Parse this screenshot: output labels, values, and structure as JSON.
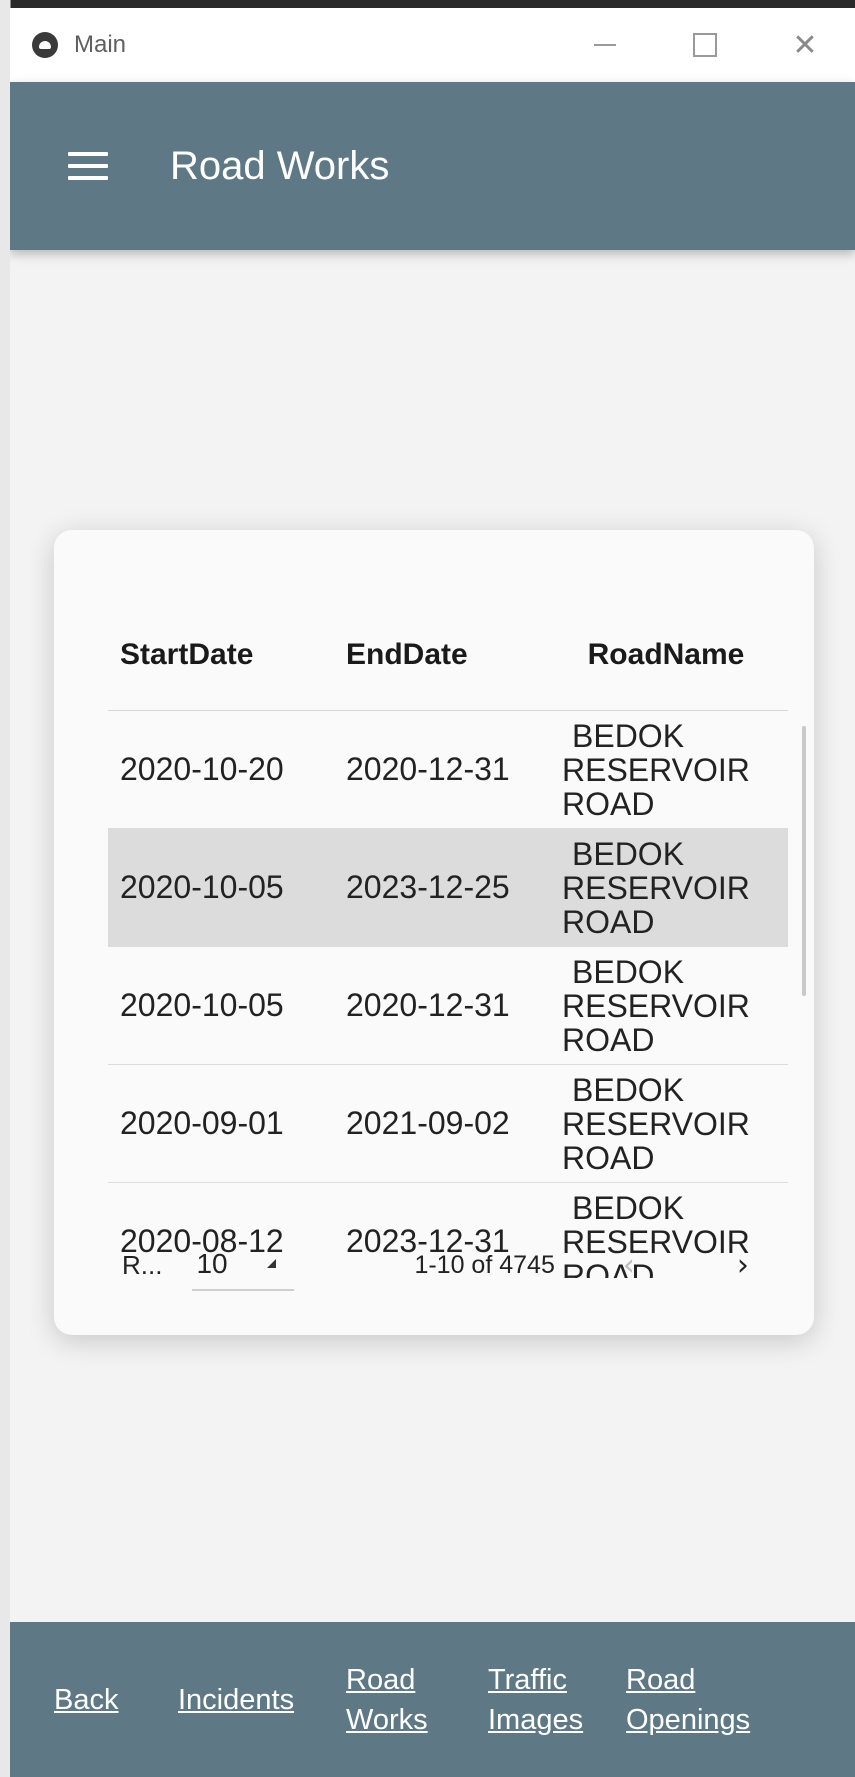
{
  "window": {
    "title": "Main",
    "minimize_icon": "minimize-icon",
    "maximize_icon": "maximize-icon",
    "close_symbol": "✕"
  },
  "appbar": {
    "menu_icon": "hamburger-menu-icon",
    "title": "Road Works"
  },
  "table": {
    "columns": [
      "StartDate",
      "EndDate",
      "RoadName"
    ],
    "rows": [
      {
        "start": "2020-10-20",
        "end": "2020-12-31",
        "road": [
          "BEDOK",
          "RESERVOIR",
          "ROAD"
        ],
        "selected": false
      },
      {
        "start": "2020-10-05",
        "end": "2023-12-25",
        "road": [
          "BEDOK",
          "RESERVOIR",
          "ROAD"
        ],
        "selected": true
      },
      {
        "start": "2020-10-05",
        "end": "2020-12-31",
        "road": [
          "BEDOK",
          "RESERVOIR",
          "ROAD"
        ],
        "selected": false
      },
      {
        "start": "2020-09-01",
        "end": "2021-09-02",
        "road": [
          "BEDOK",
          "RESERVOIR",
          "ROAD"
        ],
        "selected": false
      },
      {
        "start": "2020-08-12",
        "end": "2023-12-31",
        "road": [
          "BEDOK",
          "RESERVOIR",
          "ROAD"
        ],
        "selected": false
      }
    ]
  },
  "pagination": {
    "rows_label": "R...",
    "rows_per_page": "10",
    "range": "1-10 of 4745",
    "prev_symbol": "‹",
    "next_symbol": "›"
  },
  "bottom_nav": {
    "back": "Back",
    "incidents": "Incidents",
    "road_works_1": "Road",
    "road_works_2": "Works",
    "traffic_images_1": "Traffic",
    "traffic_images_2": "Images",
    "road_openings_1": "Road",
    "road_openings_2": "Openings"
  },
  "colors": {
    "appbar": "#5e7886",
    "selected_row": "#dcdcdc",
    "background": "#f3f3f3"
  }
}
